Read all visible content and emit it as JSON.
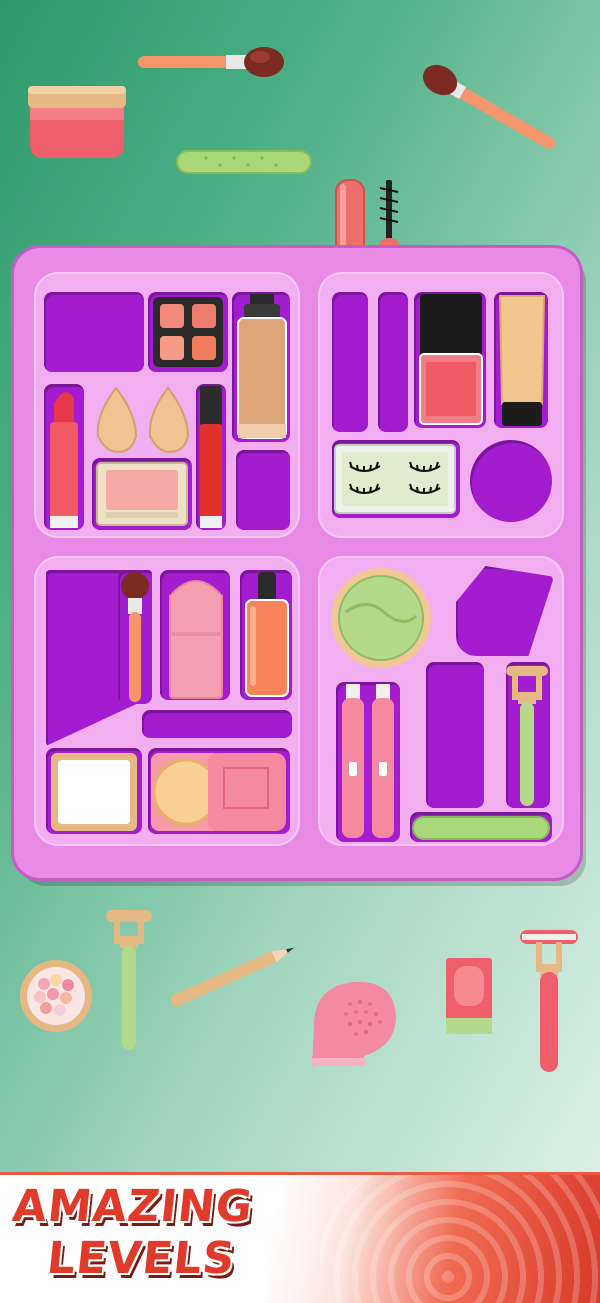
{
  "banner": {
    "line1": "AMAZING",
    "line2": "LEVELS"
  },
  "colors": {
    "background_start": "#2f9a6c",
    "background_end": "#e6f4ee",
    "tray": "#e98be6",
    "tray_panel": "#f2aef0",
    "slot": "#a41ccf",
    "banner_text": "#e03a2a"
  },
  "loose_items": [
    "face-cream-jar-icon",
    "makeup-brush-icon",
    "nail-file-icon",
    "angled-brush-icon",
    "blush-ball-compact-icon",
    "face-roller-icon",
    "eyeliner-pencil-icon",
    "facial-cleansing-brush-icon",
    "serum-bottle-icon",
    "rose-quartz-roller-icon",
    "lip-gloss-wand-icon",
    "mascara-wand-icon"
  ],
  "tray_items": [
    "eyeshadow-palette-icon",
    "foundation-bottle-icon",
    "lipstick-icon",
    "beauty-sponge-icon",
    "blush-compact-icon",
    "liquid-lipstick-icon",
    "nail-polish-icon",
    "concealer-tube-icon",
    "false-eyelashes-icon",
    "brush-icon",
    "cushion-compact-icon",
    "perfume-bottle-icon",
    "pressed-powder-icon",
    "powder-puff-compact-icon",
    "eye-gel-pads-icon",
    "brow-trimmer-icon",
    "roller-icon",
    "nail-file-icon"
  ]
}
